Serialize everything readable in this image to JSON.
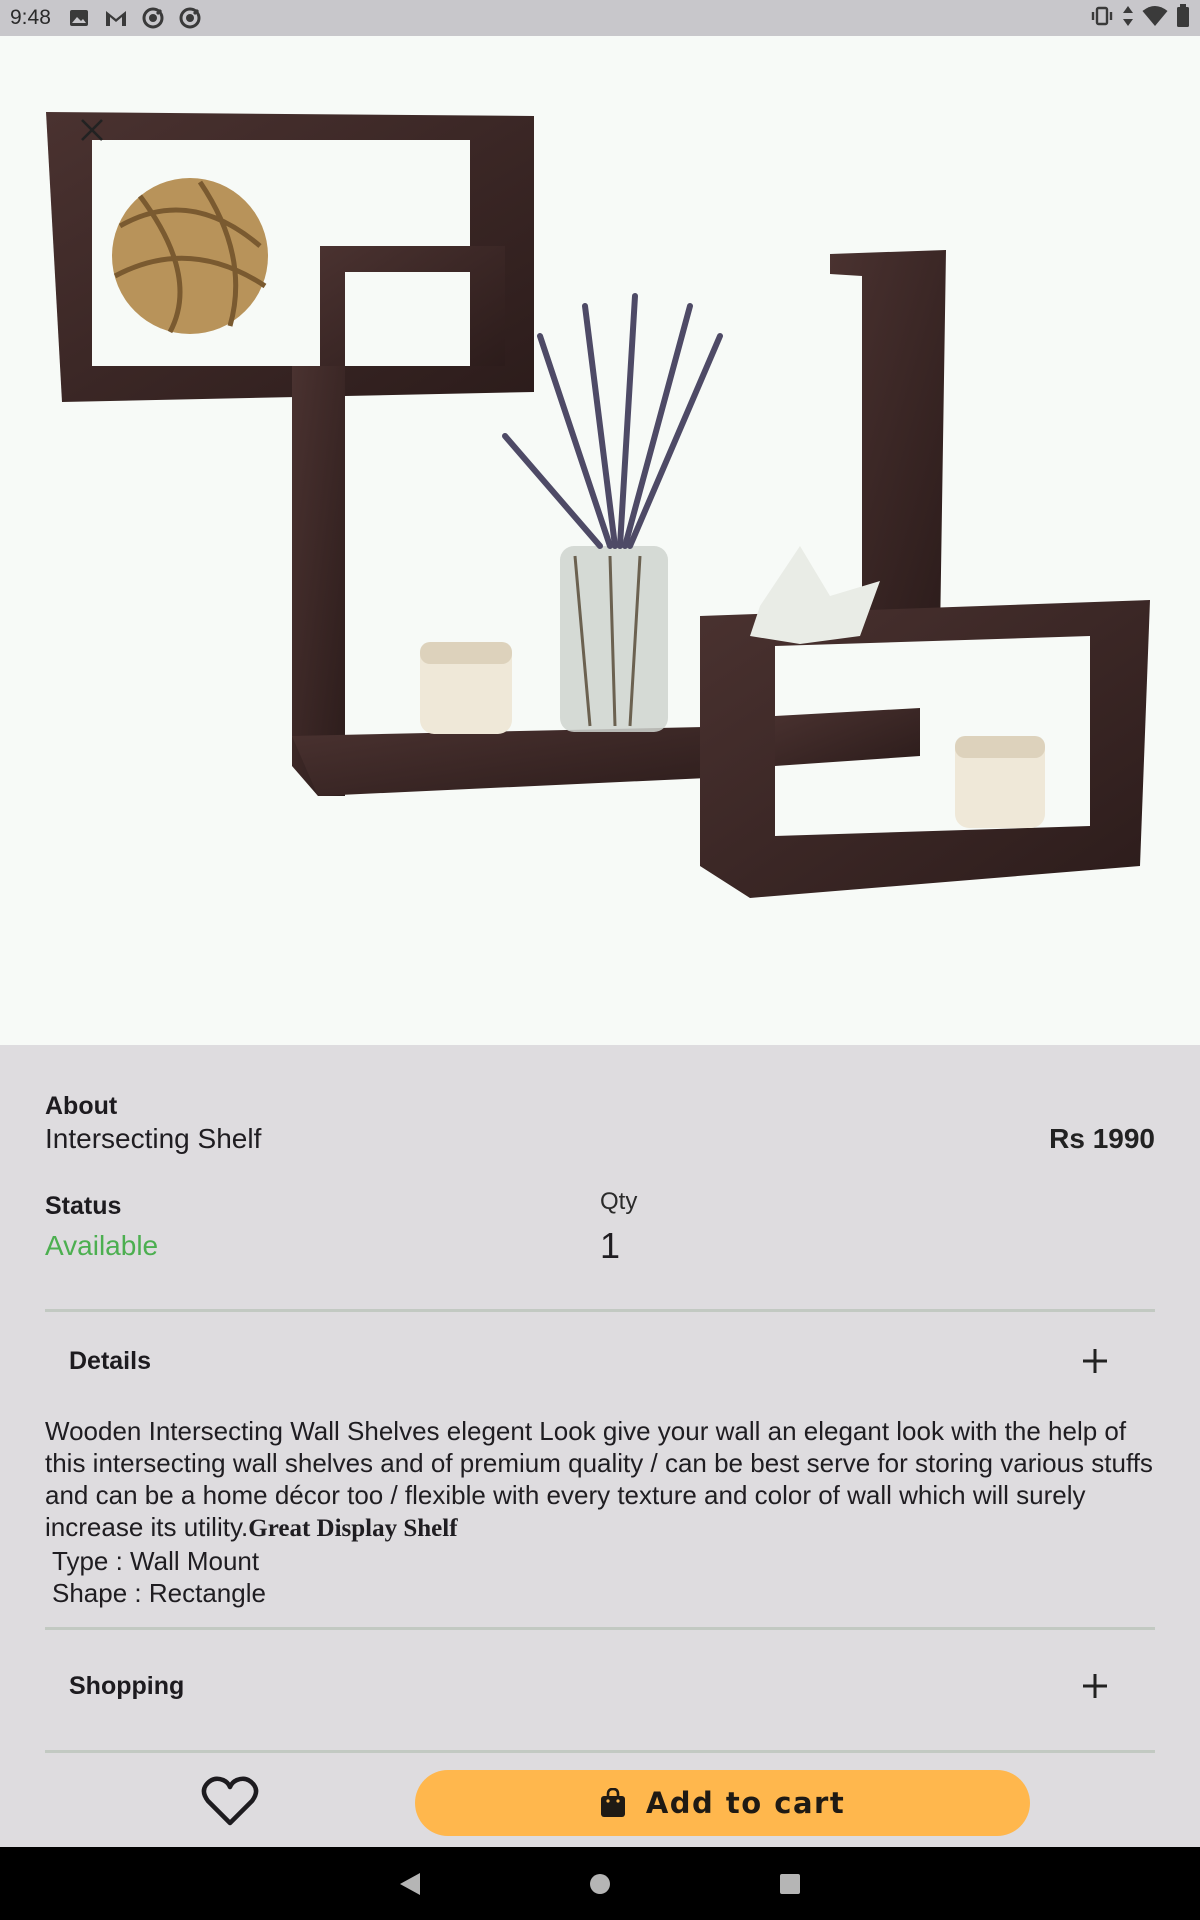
{
  "status_bar": {
    "time": "9:48",
    "left_icons": [
      "image-icon",
      "gmail-icon",
      "sync-icon",
      "sync-icon"
    ],
    "right_icons": [
      "vibrate-icon",
      "data-arrows-icon",
      "wifi-icon",
      "battery-icon"
    ]
  },
  "hero": {
    "close_icon": "close-icon",
    "image_description_name": "wall-shelf-product-image"
  },
  "product": {
    "about_label": "About",
    "name": "Intersecting Shelf",
    "price": "Rs 1990",
    "status_label": "Status",
    "status_value": "Available",
    "qty_label": "Qty",
    "qty_value": "1"
  },
  "sections": {
    "details_title": "Details",
    "shopping_title": "Shopping"
  },
  "description": {
    "text": "Wooden Intersecting Wall Shelves elegent Look give your wall an elegant look with the help of this intersecting wall shelves and of premium quality / can be best serve for storing various stuffs and can be a home décor too / flexible with every texture and color of wall which will surely increase its utility.",
    "highlight": "Great Display Shelf",
    "type_line": "Type : Wall Mount",
    "shape_line": "Shape : Rectangle"
  },
  "actions": {
    "favorite_icon": "heart-icon",
    "add_to_cart_label": "Add to cart",
    "cart_icon": "shopping-bag-icon"
  },
  "colors": {
    "accent_button": "#ffb74d",
    "status_available": "#4caf50",
    "panel_background": "#dedcdf",
    "hero_background": "#f7faf7"
  }
}
